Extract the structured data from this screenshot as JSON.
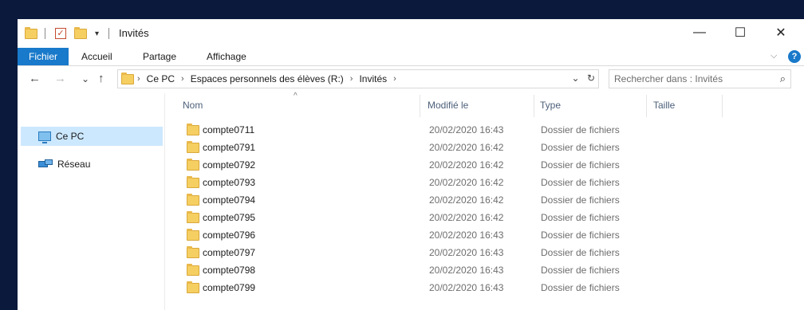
{
  "window": {
    "title": "Invités",
    "minimize": "—",
    "maximize": "☐",
    "close": "✕"
  },
  "ribbon": {
    "tabs": [
      "Fichier",
      "Accueil",
      "Partage",
      "Affichage"
    ],
    "expand": "⌵",
    "help": "?"
  },
  "nav": {
    "back": "←",
    "forward": "→",
    "recent": "⌄",
    "up": "↑",
    "breadcrumb": [
      "Ce PC",
      "Espaces personnels des élèves (R:)",
      "Invités"
    ],
    "dropdown": "⌄",
    "refresh": "↻",
    "search_placeholder": "Rechercher dans : Invités",
    "search_icon": "⌕"
  },
  "sidebar": {
    "items": [
      {
        "label": "Ce PC",
        "icon": "computer-icon",
        "selected": true
      },
      {
        "label": "Réseau",
        "icon": "network-icon",
        "selected": false
      }
    ]
  },
  "columns": {
    "name": "Nom",
    "modified": "Modifié le",
    "type": "Type",
    "size": "Taille",
    "sort_indicator": "^"
  },
  "files": [
    {
      "name": "compte0711",
      "date": "20/02/2020 16:43",
      "type": "Dossier de fichiers"
    },
    {
      "name": "compte0791",
      "date": "20/02/2020 16:42",
      "type": "Dossier de fichiers"
    },
    {
      "name": "compte0792",
      "date": "20/02/2020 16:42",
      "type": "Dossier de fichiers"
    },
    {
      "name": "compte0793",
      "date": "20/02/2020 16:42",
      "type": "Dossier de fichiers"
    },
    {
      "name": "compte0794",
      "date": "20/02/2020 16:42",
      "type": "Dossier de fichiers"
    },
    {
      "name": "compte0795",
      "date": "20/02/2020 16:42",
      "type": "Dossier de fichiers"
    },
    {
      "name": "compte0796",
      "date": "20/02/2020 16:43",
      "type": "Dossier de fichiers"
    },
    {
      "name": "compte0797",
      "date": "20/02/2020 16:43",
      "type": "Dossier de fichiers"
    },
    {
      "name": "compte0798",
      "date": "20/02/2020 16:43",
      "type": "Dossier de fichiers"
    },
    {
      "name": "compte0799",
      "date": "20/02/2020 16:43",
      "type": "Dossier de fichiers"
    }
  ],
  "colors": {
    "accent": "#1979ca",
    "selection": "#cce8ff",
    "folder": "#f6cf62",
    "desktop": "#0b1a3c"
  }
}
